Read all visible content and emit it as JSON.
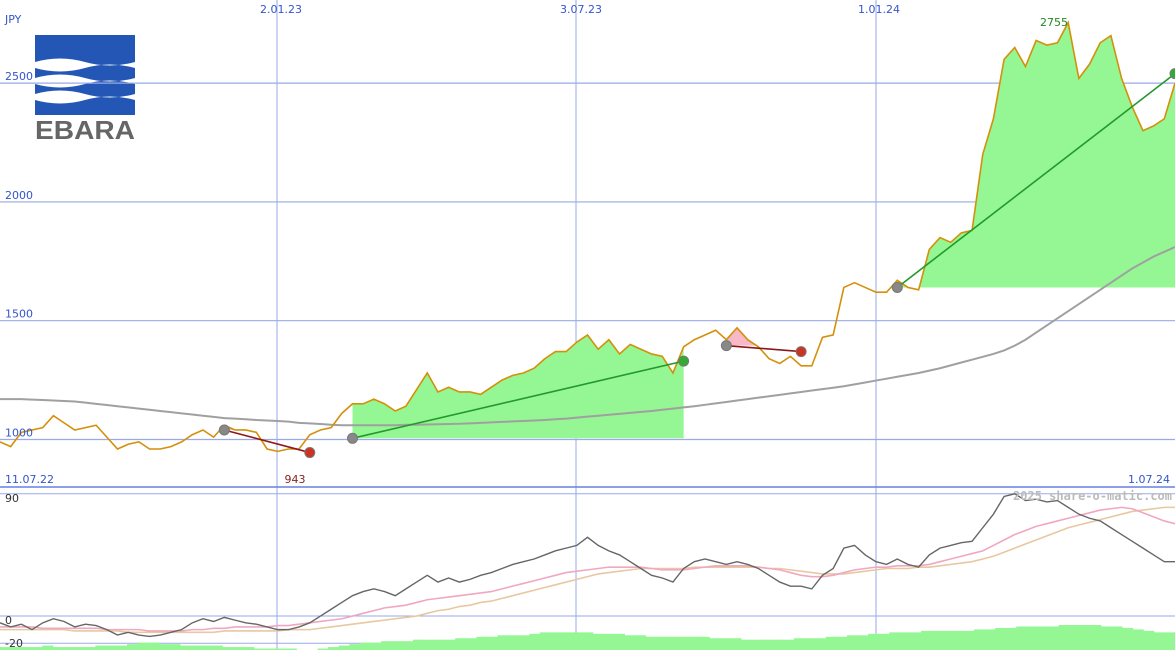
{
  "chart_data": {
    "type": "line",
    "currency": "JPY",
    "logo_text": "EBARA",
    "copyright": "2025 share-o-matic.com",
    "x_top_ticks": [
      "2.01.23",
      "3.07.23",
      "1.01.24"
    ],
    "x_bottom_left": "11.07.22",
    "x_bottom_right": "1.07.24",
    "y_ticks": [
      "2500",
      "2000",
      "1500",
      "1000"
    ],
    "y_tick_values": [
      2500,
      2000,
      1500,
      1000
    ],
    "ylim": [
      800,
      2850
    ],
    "annotations": {
      "max_label": "2755",
      "min_label": "943"
    },
    "price": [
      990,
      970,
      1030,
      1040,
      1050,
      1100,
      1070,
      1040,
      1050,
      1060,
      1010,
      960,
      980,
      990,
      960,
      960,
      970,
      990,
      1020,
      1040,
      1010,
      1060,
      1040,
      1040,
      1030,
      960,
      950,
      960,
      960,
      1020,
      1040,
      1050,
      1110,
      1150,
      1150,
      1170,
      1150,
      1120,
      1140,
      1210,
      1280,
      1200,
      1220,
      1200,
      1200,
      1190,
      1220,
      1250,
      1270,
      1280,
      1300,
      1340,
      1370,
      1370,
      1410,
      1440,
      1380,
      1420,
      1360,
      1400,
      1380,
      1360,
      1350,
      1280,
      1390,
      1420,
      1440,
      1460,
      1420,
      1470,
      1420,
      1390,
      1340,
      1320,
      1350,
      1310,
      1310,
      1430,
      1440,
      1640,
      1660,
      1640,
      1620,
      1620,
      1670,
      1640,
      1630,
      1800,
      1850,
      1830,
      1870,
      1880,
      2200,
      2350,
      2600,
      2650,
      2570,
      2680,
      2660,
      2670,
      2755,
      2520,
      2580,
      2670,
      2700,
      2520,
      2400,
      2300,
      2320,
      2350,
      2500
    ],
    "ma200": [
      1170,
      1170,
      1170,
      1168,
      1166,
      1164,
      1162,
      1160,
      1155,
      1150,
      1145,
      1140,
      1135,
      1130,
      1125,
      1120,
      1115,
      1110,
      1105,
      1100,
      1095,
      1090,
      1088,
      1085,
      1082,
      1080,
      1078,
      1075,
      1070,
      1068,
      1065,
      1062,
      1060,
      1060,
      1060,
      1060,
      1060,
      1060,
      1062,
      1062,
      1063,
      1064,
      1065,
      1066,
      1068,
      1070,
      1072,
      1074,
      1076,
      1078,
      1080,
      1082,
      1085,
      1088,
      1092,
      1096,
      1100,
      1104,
      1108,
      1112,
      1116,
      1120,
      1125,
      1130,
      1135,
      1140,
      1146,
      1152,
      1158,
      1164,
      1170,
      1176,
      1182,
      1188,
      1194,
      1200,
      1206,
      1212,
      1218,
      1224,
      1232,
      1240,
      1248,
      1256,
      1264,
      1272,
      1280,
      1290,
      1300,
      1312,
      1324,
      1336,
      1348,
      1360,
      1375,
      1395,
      1420,
      1450,
      1480,
      1510,
      1540,
      1570,
      1600,
      1630,
      1660,
      1690,
      1720,
      1745,
      1770,
      1790,
      1810
    ],
    "trades": [
      {
        "start_idx": 21,
        "end_idx": 29,
        "start": 1040,
        "end": 945,
        "result": "loss"
      },
      {
        "start_idx": 33,
        "end_idx": 64,
        "start": 1005,
        "end": 1330,
        "result": "gain"
      },
      {
        "start_idx": 68,
        "end_idx": 75,
        "start": 1395,
        "end": 1370,
        "result": "loss"
      },
      {
        "start_idx": 84,
        "end_idx": 110,
        "start": 1640,
        "end": 2540,
        "result": "gain"
      }
    ],
    "oscillator": {
      "y_ticks": [
        "90",
        "0",
        "-20"
      ],
      "y_tick_values": [
        90,
        0,
        -20
      ],
      "ylim": [
        -25,
        95
      ],
      "line": [
        -5,
        -8,
        -6,
        -10,
        -5,
        -2,
        -4,
        -8,
        -6,
        -7,
        -10,
        -14,
        -12,
        -14,
        -15,
        -14,
        -12,
        -10,
        -5,
        -2,
        -4,
        -1,
        -3,
        -5,
        -6,
        -8,
        -10,
        -10,
        -8,
        -5,
        0,
        5,
        10,
        15,
        18,
        20,
        18,
        15,
        20,
        25,
        30,
        25,
        28,
        25,
        27,
        30,
        32,
        35,
        38,
        40,
        42,
        45,
        48,
        50,
        52,
        58,
        52,
        48,
        45,
        40,
        35,
        30,
        28,
        25,
        35,
        40,
        42,
        40,
        38,
        40,
        38,
        35,
        30,
        25,
        22,
        22,
        20,
        30,
        35,
        50,
        52,
        45,
        40,
        38,
        42,
        38,
        36,
        45,
        50,
        52,
        54,
        55,
        65,
        75,
        88,
        90,
        85,
        86,
        84,
        85,
        80,
        75,
        72,
        70,
        65,
        60,
        55,
        50,
        45,
        40,
        40
      ],
      "signal_pink": [
        -8,
        -8,
        -8,
        -8,
        -9,
        -9,
        -9,
        -9,
        -9,
        -9,
        -10,
        -10,
        -10,
        -10,
        -11,
        -11,
        -11,
        -11,
        -10,
        -10,
        -9,
        -9,
        -8,
        -8,
        -8,
        -8,
        -7,
        -7,
        -6,
        -5,
        -4,
        -3,
        -2,
        0,
        2,
        4,
        6,
        7,
        8,
        10,
        12,
        13,
        14,
        15,
        16,
        17,
        18,
        20,
        22,
        24,
        26,
        28,
        30,
        32,
        33,
        34,
        35,
        36,
        36,
        36,
        36,
        35,
        34,
        34,
        34,
        35,
        36,
        37,
        37,
        37,
        37,
        36,
        35,
        34,
        32,
        30,
        29,
        29,
        30,
        32,
        34,
        35,
        36,
        36,
        37,
        37,
        37,
        38,
        40,
        42,
        44,
        46,
        48,
        52,
        56,
        60,
        63,
        66,
        68,
        70,
        72,
        74,
        76,
        78,
        79,
        80,
        79,
        76,
        73,
        70,
        68
      ],
      "signal_tan": [
        -10,
        -10,
        -10,
        -10,
        -10,
        -10,
        -10,
        -11,
        -11,
        -11,
        -11,
        -11,
        -12,
        -12,
        -12,
        -12,
        -12,
        -12,
        -12,
        -12,
        -12,
        -11,
        -11,
        -11,
        -11,
        -11,
        -11,
        -10,
        -10,
        -10,
        -9,
        -8,
        -7,
        -6,
        -5,
        -4,
        -3,
        -2,
        -1,
        0,
        2,
        4,
        5,
        7,
        8,
        10,
        11,
        13,
        15,
        17,
        19,
        21,
        23,
        25,
        27,
        29,
        31,
        32,
        33,
        34,
        35,
        35,
        35,
        35,
        35,
        36,
        36,
        36,
        36,
        36,
        36,
        36,
        35,
        35,
        34,
        33,
        32,
        31,
        31,
        31,
        32,
        33,
        34,
        35,
        35,
        35,
        36,
        36,
        37,
        38,
        39,
        40,
        42,
        44,
        47,
        50,
        53,
        56,
        59,
        62,
        65,
        67,
        69,
        71,
        73,
        75,
        77,
        78,
        79,
        80,
        80
      ],
      "volume": [
        2,
        2,
        2,
        2,
        3,
        2,
        2,
        2,
        2,
        3,
        3,
        3,
        4,
        5,
        5,
        4,
        4,
        3,
        3,
        3,
        3,
        2,
        2,
        2,
        1,
        1,
        1,
        1,
        0,
        0,
        1,
        2,
        3,
        4,
        5,
        5,
        6,
        6,
        6,
        7,
        7,
        7,
        7,
        8,
        8,
        9,
        9,
        10,
        10,
        10,
        11,
        12,
        12,
        12,
        12,
        12,
        11,
        11,
        11,
        10,
        10,
        9,
        9,
        9,
        9,
        9,
        9,
        8,
        8,
        8,
        7,
        7,
        7,
        7,
        7,
        8,
        8,
        8,
        9,
        9,
        10,
        10,
        11,
        11,
        12,
        12,
        12,
        13,
        13,
        13,
        13,
        13,
        14,
        14,
        15,
        15,
        16,
        16,
        16,
        16,
        17,
        17,
        17,
        17,
        16,
        16,
        15,
        14,
        13,
        12,
        12
      ]
    }
  }
}
